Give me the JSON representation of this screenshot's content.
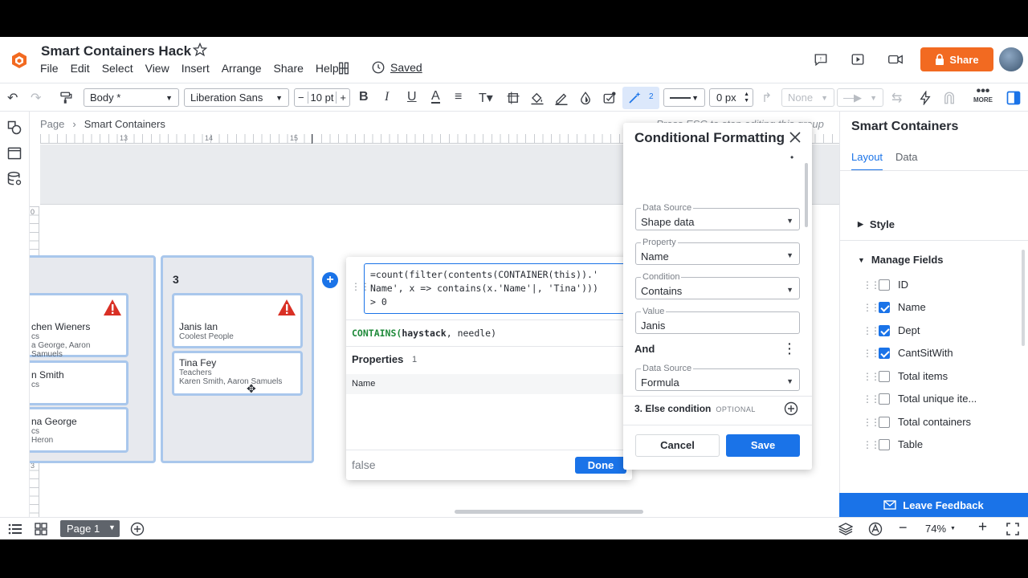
{
  "header": {
    "title": "Smart Containers Hack",
    "menu": [
      "File",
      "Edit",
      "Select",
      "View",
      "Insert",
      "Arrange",
      "Share",
      "Help"
    ],
    "saved_label": "Saved",
    "share_label": "Share"
  },
  "toolbar": {
    "text_style": "Body *",
    "font": "Liberation Sans",
    "font_size": "10 pt",
    "badge_count": "2",
    "line_width": "0 px",
    "arrow_none": "None",
    "more_label": "MORE"
  },
  "breadcrumb": {
    "root": "Page",
    "current": "Smart Containers"
  },
  "canvas": {
    "hint": "Press ESC to stop editing this group",
    "ruler_top": [
      "13",
      "14",
      "15"
    ],
    "ruler_left": [
      "0",
      "1",
      "2",
      "3"
    ],
    "container_label": "3",
    "left_cards": [
      {
        "name": "chen Wieners",
        "dept": "cs",
        "cant": "a George, Aaron Samuels"
      },
      {
        "name": "n Smith",
        "dept": "cs",
        "cant": ""
      },
      {
        "name": "na George",
        "dept": "cs",
        "cant": "Heron"
      }
    ],
    "right_cards": [
      {
        "name": "Janis Ian",
        "dept": "Coolest People",
        "cant": ""
      },
      {
        "name": "Tina Fey",
        "dept": "Teachers",
        "cant": "Karen Smith, Aaron Samuels"
      }
    ]
  },
  "formula": {
    "text": "=count(filter(contents(CONTAINER(this)).'\nName', x => contains(x.'Name'|, 'Tina')))\n> 0",
    "fn_name": "CONTAINS",
    "fn_arg1": "haystack",
    "fn_rest": ", needle)",
    "properties_label": "Properties",
    "properties_count": "1",
    "property": "Name",
    "result": "false",
    "done_label": "Done"
  },
  "conditional_formatting": {
    "title": "Conditional Formatting",
    "fields": [
      {
        "label": "Data Source",
        "value": "Shape data",
        "dropdown": true
      },
      {
        "label": "Property",
        "value": "Name",
        "dropdown": true
      },
      {
        "label": "Condition",
        "value": "Contains",
        "dropdown": true
      },
      {
        "label": "Value",
        "value": "Janis",
        "dropdown": false
      }
    ],
    "and_label": "And",
    "second_source": {
      "label": "Data Source",
      "value": "Formula"
    },
    "else_label": "3. Else condition",
    "optional_label": "OPTIONAL",
    "cancel_label": "Cancel",
    "save_label": "Save"
  },
  "right_panel": {
    "title": "Smart Containers",
    "tabs": [
      "Layout",
      "Data"
    ],
    "style_label": "Style",
    "manage_label": "Manage Fields",
    "fields": [
      {
        "name": "ID",
        "checked": false
      },
      {
        "name": "Name",
        "checked": true
      },
      {
        "name": "Dept",
        "checked": true
      },
      {
        "name": "CantSitWith",
        "checked": true
      },
      {
        "name": "Total items",
        "checked": false
      },
      {
        "name": "Total unique ite...",
        "checked": false
      },
      {
        "name": "Total containers",
        "checked": false
      },
      {
        "name": "Table",
        "checked": false
      }
    ],
    "feedback_label": "Leave Feedback"
  },
  "bottom": {
    "page_label": "Page 1",
    "zoom": "74%"
  },
  "colors": {
    "accent": "#1a73e8",
    "share": "#f26a21",
    "warning": "#d93025"
  }
}
